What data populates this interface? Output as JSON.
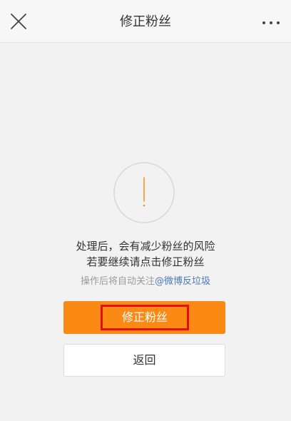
{
  "header": {
    "title": "修正粉丝",
    "close_icon": "close-icon",
    "more_icon": "more-icon"
  },
  "alert": {
    "icon": "exclamation-icon",
    "accent_color": "#fb8a15"
  },
  "message": {
    "line1": "处理后，会有减少粉丝的风险",
    "line2": "若要继续请点击修正粉丝",
    "note_prefix": "操作后将自动关注",
    "note_link": "@微博反垃圾"
  },
  "buttons": {
    "primary_label": "修正粉丝",
    "secondary_label": "返回"
  }
}
